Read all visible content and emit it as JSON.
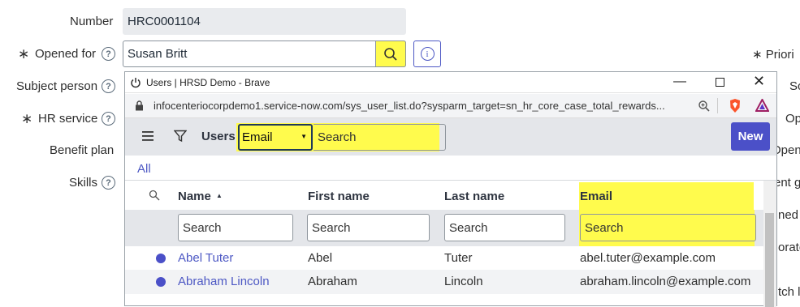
{
  "form": {
    "number_label": "Number",
    "number_value": "HRC0001104",
    "opened_for_label": "Opened for",
    "opened_for_value": "Susan Britt",
    "subject_person_label": "Subject person",
    "hr_service_label": "HR service",
    "benefit_plan_label": "Benefit plan",
    "skills_label": "Skills",
    "required_mark": "∗",
    "help_mark": "?",
    "right_labels": [
      "∗ Priori",
      "Sc",
      "Op",
      "Open",
      "ent g",
      "ned",
      "orato",
      "tch li"
    ]
  },
  "popup": {
    "window_title": "Users | HRSD Demo - Brave",
    "url": "infocenteriocorpdemo1.service-now.com/sys_user_list.do?sysparm_target=sn_hr_core_case_total_rewards...",
    "list_title": "Users",
    "search_field_selected": "Email",
    "search_placeholder": "Search",
    "new_button": "New",
    "breadcrumb": "All",
    "columns": [
      "Name",
      "First name",
      "Last name",
      "Email"
    ],
    "column_search_placeholder": "Search",
    "rows": [
      {
        "name": "Abel Tuter",
        "first": "Abel",
        "last": "Tuter",
        "email": "abel.tuter@example.com"
      },
      {
        "name": "Abraham Lincoln",
        "first": "Abraham",
        "last": "Lincoln",
        "email": "abraham.lincoln@example.com"
      }
    ]
  },
  "colors": {
    "accent": "#4b50c8",
    "highlight": "#fffb4d"
  }
}
